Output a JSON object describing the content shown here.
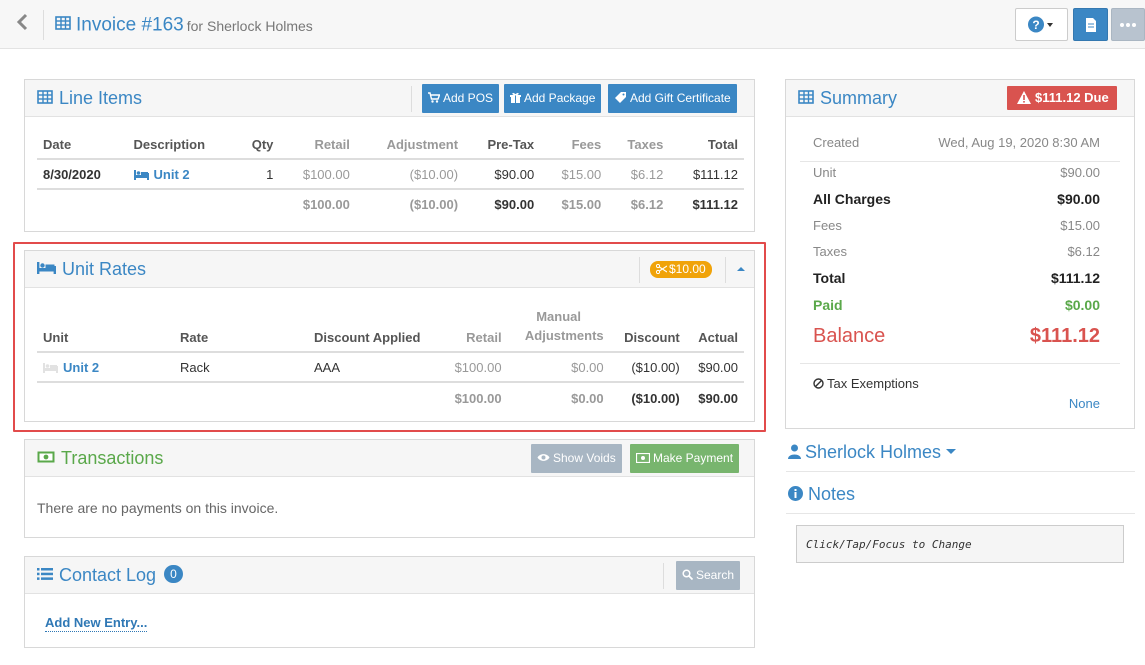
{
  "header": {
    "invoice_title": "Invoice #163",
    "customer_suffix": "for Sherlock Holmes",
    "help_label": "?"
  },
  "line_items": {
    "title": "Line Items",
    "buttons": {
      "add_pos": "Add POS",
      "add_package": "Add Package",
      "add_gift": "Add Gift Certificate"
    },
    "columns": [
      "Date",
      "Description",
      "Qty",
      "Retail",
      "Adjustment",
      "Pre-Tax",
      "Fees",
      "Taxes",
      "Total"
    ],
    "rows": [
      {
        "date": "8/30/2020",
        "description": "Unit 2",
        "qty": "1",
        "retail": "$100.00",
        "adjustment": "($10.00)",
        "pretax": "$90.00",
        "fees": "$15.00",
        "taxes": "$6.12",
        "total": "$111.12"
      }
    ],
    "totals": {
      "retail": "$100.00",
      "adjustment": "($10.00)",
      "pretax": "$90.00",
      "fees": "$15.00",
      "taxes": "$6.12",
      "total": "$111.12"
    }
  },
  "unit_rates": {
    "title": "Unit Rates",
    "discount_badge": "$10.00",
    "columns": {
      "unit": "Unit",
      "rate": "Rate",
      "discount_applied": "Discount Applied",
      "retail": "Retail",
      "manual_top": "Manual",
      "manual_bottom": "Adjustments",
      "discount": "Discount",
      "actual": "Actual"
    },
    "rows": [
      {
        "unit": "Unit 2",
        "rate": "Rack",
        "discount_applied": "AAA",
        "retail": "$100.00",
        "manual": "$0.00",
        "discount": "($10.00)",
        "actual": "$90.00"
      }
    ],
    "totals": {
      "retail": "$100.00",
      "manual": "$0.00",
      "discount": "($10.00)",
      "actual": "$90.00"
    }
  },
  "transactions": {
    "title": "Transactions",
    "show_voids": "Show Voids",
    "make_payment": "Make Payment",
    "empty_text": "There are no payments on this invoice."
  },
  "contact_log": {
    "title": "Contact Log",
    "count": "0",
    "search": "Search",
    "add_entry": "Add New Entry..."
  },
  "summary": {
    "title": "Summary",
    "due_badge": "$111.12 Due",
    "created_label": "Created",
    "created_value": "Wed, Aug 19, 2020 8:30 AM",
    "unit_label": "Unit",
    "unit_value": "$90.00",
    "all_charges_label": "All Charges",
    "all_charges_value": "$90.00",
    "fees_label": "Fees",
    "fees_value": "$15.00",
    "taxes_label": "Taxes",
    "taxes_value": "$6.12",
    "total_label": "Total",
    "total_value": "$111.12",
    "paid_label": "Paid",
    "paid_value": "$0.00",
    "balance_label": "Balance",
    "balance_value": "$111.12",
    "tax_exemptions_label": "Tax Exemptions",
    "tax_exemptions_value": "None"
  },
  "customer": {
    "name": "Sherlock Holmes"
  },
  "notes": {
    "title": "Notes",
    "placeholder": "Click/Tap/Focus to Change"
  },
  "colors": {
    "accent": "#3b87c4",
    "danger": "#d9534f",
    "success": "#5cb85c",
    "warning": "#f0ad4e",
    "highlight": "#e24b4b"
  }
}
